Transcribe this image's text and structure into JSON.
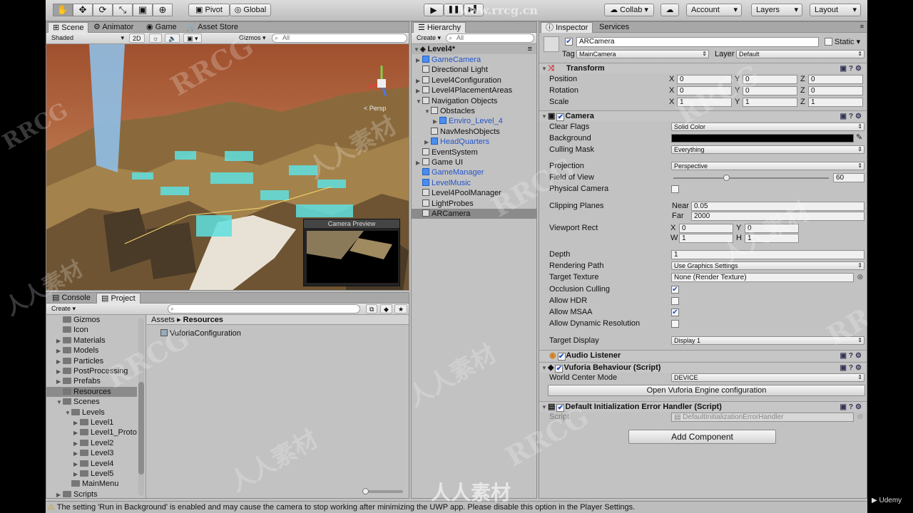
{
  "toolbar": {
    "tools": [
      "hand-icon",
      "move-icon",
      "rotate-icon",
      "scale-icon",
      "rect-icon",
      "transform-icon"
    ],
    "pivot": "Pivot",
    "global": "Global",
    "collab": "Collab",
    "account": "Account",
    "layers": "Layers",
    "layout": "Layout"
  },
  "scene": {
    "tabs": [
      "Scene",
      "Animator",
      "Game",
      "Asset Store"
    ],
    "shaded": "Shaded",
    "mode2d": "2D",
    "gizmos": "Gizmos",
    "search_placeholder": "All",
    "persp": "< Persp",
    "camera_preview": "Camera Preview"
  },
  "hierarchy": {
    "tab": "Hierarchy",
    "create": "Create",
    "search_placeholder": "All",
    "scene_name": "Level4*",
    "items": [
      {
        "label": "GameCamera",
        "indent": 1,
        "arrow": "▶",
        "blue": true
      },
      {
        "label": "Directional Light",
        "indent": 1,
        "arrow": "",
        "blue": false
      },
      {
        "label": "Level4Configuration",
        "indent": 1,
        "arrow": "▶",
        "blue": false
      },
      {
        "label": "Level4PlacementAreas",
        "indent": 1,
        "arrow": "▶",
        "blue": false
      },
      {
        "label": "Navigation Objects",
        "indent": 1,
        "arrow": "▼",
        "blue": false
      },
      {
        "label": "Obstacles",
        "indent": 2,
        "arrow": "▼",
        "blue": false
      },
      {
        "label": "Enviro_Level_4",
        "indent": 3,
        "arrow": "▶",
        "blue": true
      },
      {
        "label": "NavMeshObjects",
        "indent": 2,
        "arrow": "",
        "blue": false
      },
      {
        "label": "HeadQuarters",
        "indent": 2,
        "arrow": "▶",
        "blue": true
      },
      {
        "label": "EventSystem",
        "indent": 1,
        "arrow": "",
        "blue": false
      },
      {
        "label": "Game UI",
        "indent": 1,
        "arrow": "▶",
        "blue": false
      },
      {
        "label": "GameManager",
        "indent": 1,
        "arrow": "",
        "blue": true
      },
      {
        "label": "LevelMusic",
        "indent": 1,
        "arrow": "",
        "blue": true
      },
      {
        "label": "Level4PoolManager",
        "indent": 1,
        "arrow": "",
        "blue": false
      },
      {
        "label": "LightProbes",
        "indent": 1,
        "arrow": "",
        "blue": false
      },
      {
        "label": "ARCamera",
        "indent": 1,
        "arrow": "",
        "blue": false
      }
    ]
  },
  "project": {
    "tabs": [
      "Console",
      "Project"
    ],
    "create": "Create",
    "breadcrumb_root": "Assets",
    "breadcrumb_sep": "▸",
    "breadcrumb_current": "Resources",
    "tree": [
      {
        "label": "Gizmos",
        "indent": 1,
        "arrow": ""
      },
      {
        "label": "Icon",
        "indent": 1,
        "arrow": ""
      },
      {
        "label": "Materials",
        "indent": 1,
        "arrow": "▶"
      },
      {
        "label": "Models",
        "indent": 1,
        "arrow": "▶"
      },
      {
        "label": "Particles",
        "indent": 1,
        "arrow": "▶"
      },
      {
        "label": "PostProcessing",
        "indent": 1,
        "arrow": "▶"
      },
      {
        "label": "Prefabs",
        "indent": 1,
        "arrow": "▶"
      },
      {
        "label": "Resources",
        "indent": 1,
        "arrow": ""
      },
      {
        "label": "Scenes",
        "indent": 1,
        "arrow": "▼"
      },
      {
        "label": "Levels",
        "indent": 2,
        "arrow": "▼"
      },
      {
        "label": "Level1",
        "indent": 3,
        "arrow": "▶"
      },
      {
        "label": "Level1_Proto",
        "indent": 3,
        "arrow": "▶"
      },
      {
        "label": "Level2",
        "indent": 3,
        "arrow": "▶"
      },
      {
        "label": "Level3",
        "indent": 3,
        "arrow": "▶"
      },
      {
        "label": "Level4",
        "indent": 3,
        "arrow": "▶"
      },
      {
        "label": "Level5",
        "indent": 3,
        "arrow": "▶"
      },
      {
        "label": "MainMenu",
        "indent": 2,
        "arrow": ""
      },
      {
        "label": "Scripts",
        "indent": 1,
        "arrow": "▶"
      }
    ],
    "file": "VuforiaConfiguration"
  },
  "inspector": {
    "tabs": [
      "Inspector",
      "Services"
    ],
    "object_name": "ARCamera",
    "static_label": "Static",
    "tag_label": "Tag",
    "tag_value": "MainCamera",
    "layer_label": "Layer",
    "layer_value": "Default",
    "transform": {
      "title": "Transform",
      "position_label": "Position",
      "rotation_label": "Rotation",
      "scale_label": "Scale",
      "position": [
        "0",
        "0",
        "0"
      ],
      "rotation": [
        "0",
        "0",
        "0"
      ],
      "scale": [
        "1",
        "1",
        "1"
      ]
    },
    "camera": {
      "title": "Camera",
      "clear_flags_label": "Clear Flags",
      "clear_flags": "Solid Color",
      "background_label": "Background",
      "background_color": "#000000",
      "culling_mask_label": "Culling Mask",
      "culling_mask": "Everything",
      "projection_label": "Projection",
      "projection": "Perspective",
      "fov_label": "Field of View",
      "fov": "60",
      "physical_label": "Physical Camera",
      "clipping_label": "Clipping Planes",
      "near_label": "Near",
      "near": "0.05",
      "far_label": "Far",
      "far": "2000",
      "viewport_label": "Viewport Rect",
      "vp_x": "0",
      "vp_y": "0",
      "vp_w": "1",
      "vp_h": "1",
      "depth_label": "Depth",
      "depth": "1",
      "rendering_path_label": "Rendering Path",
      "rendering_path": "Use Graphics Settings",
      "target_texture_label": "Target Texture",
      "target_texture": "None (Render Texture)",
      "occlusion_label": "Occlusion Culling",
      "hdr_label": "Allow HDR",
      "msaa_label": "Allow MSAA",
      "dynres_label": "Allow Dynamic Resolution",
      "target_display_label": "Target Display",
      "target_display": "Display 1"
    },
    "audio_title": "Audio Listener",
    "vuforia_title": "Vuforia Behaviour (Script)",
    "world_center_label": "World Center Mode",
    "world_center": "DEVICE",
    "open_vuforia": "Open Vuforia Engine configuration",
    "error_handler_title": "Default Initialization Error Handler (Script)",
    "script_label": "Script",
    "script_value": "DefaultInitializationErrorHandler",
    "add_component": "Add Component"
  },
  "status_message": "The setting 'Run in Background' is enabled and may cause the camera to stop working after minimizing the UWP app. Please disable this option in the Player Settings.",
  "watermarks": {
    "site": "www.rrcg.cn",
    "brand": "RRCG",
    "cn": "人人素材"
  },
  "udemy": "Udemy"
}
